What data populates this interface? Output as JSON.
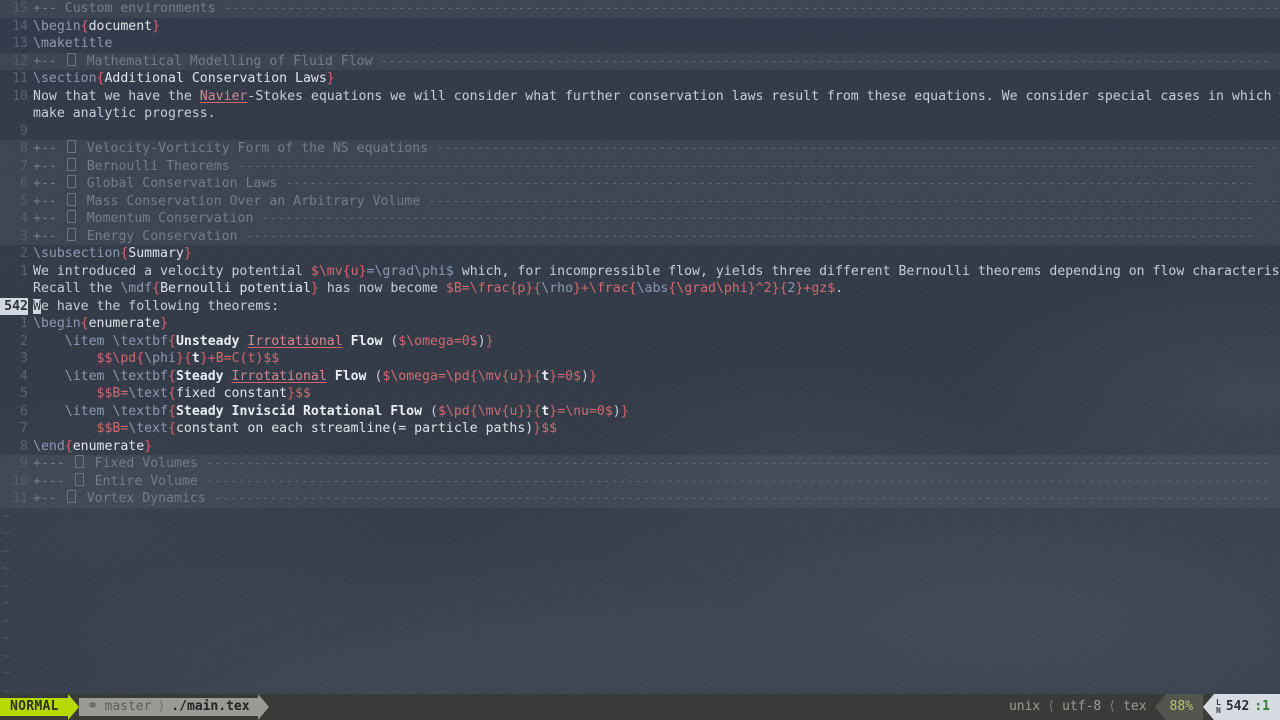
{
  "app": "neovim",
  "theme": {
    "background": "#333a47",
    "foreground": "#c8ccd4",
    "fold_bg": "#3c4453",
    "linenr": "#5a6373",
    "command": "#8b9ab3",
    "brace": "#d4636b",
    "math": "#cf6a6f",
    "spell_error_underline": "#d4636b",
    "mode_accent": "#b8d900",
    "position_accent": "#2e7d32"
  },
  "buffer": {
    "filename": "./main.tex",
    "filetype": "tex",
    "lines": [
      {
        "num": "15",
        "type": "fold",
        "marker": "+--",
        "title": "Custom environments",
        "dashes": "---------------------------------------------------------------------------------------------------------------------------------------------",
        "has_box": false
      },
      {
        "num": "14",
        "type": "code",
        "tokens": [
          {
            "t": "\\begin",
            "c": "cmd"
          },
          {
            "t": "{",
            "c": "brace"
          },
          {
            "t": "document",
            "c": "arg"
          },
          {
            "t": "}",
            "c": "brace"
          }
        ]
      },
      {
        "num": "13",
        "type": "code",
        "tokens": [
          {
            "t": "\\maketitle",
            "c": "cmd"
          }
        ]
      },
      {
        "num": "12",
        "type": "fold",
        "marker": "+--",
        "title": "Mathematical Modelling of Fluid Flow",
        "dashes": "----------------------------------------------------------------------------------------------------------------",
        "has_box": true
      },
      {
        "num": "11",
        "type": "code",
        "tokens": [
          {
            "t": "\\section",
            "c": "cmd"
          },
          {
            "t": "{",
            "c": "brace"
          },
          {
            "t": "Additional Conservation Laws",
            "c": "arg"
          },
          {
            "t": "}",
            "c": "brace"
          }
        ]
      },
      {
        "num": "10",
        "type": "code",
        "tokens": [
          {
            "t": "Now that we have the ",
            "c": "plain"
          },
          {
            "t": "Navier",
            "c": "spell"
          },
          {
            "t": "-Stokes equations we will consider what further conservation laws result from these equations. We consider special cases in which we can",
            "c": "plain"
          }
        ]
      },
      {
        "num": "",
        "type": "wrap",
        "tokens": [
          {
            "t": "make analytic progress.",
            "c": "plain"
          }
        ]
      },
      {
        "num": "9",
        "type": "code",
        "tokens": []
      },
      {
        "num": "8",
        "type": "fold",
        "marker": "+--",
        "title": "Velocity-Vorticity Form of the NS equations",
        "dashes": "----------------------------------------------------------------------------------------------------------",
        "has_box": true
      },
      {
        "num": "7",
        "type": "fold",
        "marker": "+--",
        "title": "Bernoulli Theorems",
        "dashes": "--------------------------------------------------------------------------------------------------------------------------------",
        "has_box": true
      },
      {
        "num": "6",
        "type": "fold",
        "marker": "+--",
        "title": "Global Conservation Laws",
        "dashes": "--------------------------------------------------------------------------------------------------------------------------",
        "has_box": true
      },
      {
        "num": "5",
        "type": "fold",
        "marker": "+--",
        "title": "Mass Conservation Over an Arbitrary Volume",
        "dashes": "------------------------------------------------------------------------------------------------------------",
        "has_box": true
      },
      {
        "num": "4",
        "type": "fold",
        "marker": "+--",
        "title": "Momentum Conservation",
        "dashes": "-----------------------------------------------------------------------------------------------------------------------------",
        "has_box": true
      },
      {
        "num": "3",
        "type": "fold",
        "marker": "+--",
        "title": "Energy Conservation",
        "dashes": "-------------------------------------------------------------------------------------------------------------------------------",
        "has_box": true
      },
      {
        "num": "2",
        "type": "code",
        "tokens": [
          {
            "t": "\\subsection",
            "c": "cmd"
          },
          {
            "t": "{",
            "c": "brace"
          },
          {
            "t": "Summary",
            "c": "arg"
          },
          {
            "t": "}",
            "c": "brace"
          }
        ]
      },
      {
        "num": "1",
        "type": "code",
        "tokens": [
          {
            "t": "We introduced a velocity potential ",
            "c": "plain"
          },
          {
            "t": "$\\mv",
            "c": "math"
          },
          {
            "t": "{",
            "c": "brace"
          },
          {
            "t": "u",
            "c": "math"
          },
          {
            "t": "}",
            "c": "brace"
          },
          {
            "t": "=\\grad\\phi$",
            "c": "mathblue"
          },
          {
            "t": " which, for incompressible flow, yields three different Bernoulli theorems depending on flow characteristics.",
            "c": "plain"
          }
        ]
      },
      {
        "num": "",
        "type": "wrap",
        "tokens": [
          {
            "t": "Recall the ",
            "c": "plain"
          },
          {
            "t": "\\mdf",
            "c": "cmd"
          },
          {
            "t": "{",
            "c": "brace"
          },
          {
            "t": "Bernoulli potential",
            "c": "arg"
          },
          {
            "t": "}",
            "c": "brace"
          },
          {
            "t": " has now become ",
            "c": "plain"
          },
          {
            "t": "$B=\\frac",
            "c": "math"
          },
          {
            "t": "{",
            "c": "brace"
          },
          {
            "t": "p",
            "c": "math"
          },
          {
            "t": "}",
            "c": "brace"
          },
          {
            "t": "{",
            "c": "brace"
          },
          {
            "t": "\\rho",
            "c": "mathblue"
          },
          {
            "t": "}",
            "c": "brace"
          },
          {
            "t": "+\\frac",
            "c": "math"
          },
          {
            "t": "{",
            "c": "brace"
          },
          {
            "t": "\\abs",
            "c": "mathblue"
          },
          {
            "t": "{",
            "c": "brace"
          },
          {
            "t": "\\grad\\phi",
            "c": "math"
          },
          {
            "t": "}",
            "c": "brace"
          },
          {
            "t": "^2",
            "c": "math"
          },
          {
            "t": "}",
            "c": "brace"
          },
          {
            "t": "{",
            "c": "brace"
          },
          {
            "t": "2",
            "c": "mathblue"
          },
          {
            "t": "}",
            "c": "brace"
          },
          {
            "t": "+gz$",
            "c": "math"
          },
          {
            "t": ".",
            "c": "plain"
          }
        ]
      },
      {
        "num": "542",
        "type": "cursor",
        "cursor_char": "W",
        "tokens": [
          {
            "t": "e have the following theorems:",
            "c": "plain"
          }
        ]
      },
      {
        "num": "1",
        "type": "code",
        "tokens": [
          {
            "t": "\\begin",
            "c": "cmd"
          },
          {
            "t": "{",
            "c": "brace"
          },
          {
            "t": "enumerate",
            "c": "arg"
          },
          {
            "t": "}",
            "c": "brace"
          }
        ]
      },
      {
        "num": "2",
        "type": "code",
        "tokens": [
          {
            "t": "    ",
            "c": "plain"
          },
          {
            "t": "\\item ",
            "c": "cmd"
          },
          {
            "t": "\\textbf",
            "c": "cmd"
          },
          {
            "t": "{",
            "c": "brace"
          },
          {
            "t": "Unsteady ",
            "c": "bold"
          },
          {
            "t": "Irrotational",
            "c": "spell"
          },
          {
            "t": " Flow ",
            "c": "bold"
          },
          {
            "t": "(",
            "c": "plain"
          },
          {
            "t": "$\\omega=0$",
            "c": "math"
          },
          {
            "t": ")",
            "c": "plain"
          },
          {
            "t": "}",
            "c": "brace"
          }
        ]
      },
      {
        "num": "3",
        "type": "code",
        "tokens": [
          {
            "t": "        ",
            "c": "plain"
          },
          {
            "t": "$$\\pd",
            "c": "math"
          },
          {
            "t": "{",
            "c": "brace"
          },
          {
            "t": "\\phi",
            "c": "mathblue"
          },
          {
            "t": "}",
            "c": "brace"
          },
          {
            "t": "{",
            "c": "brace"
          },
          {
            "t": "t",
            "c": "bold"
          },
          {
            "t": "}",
            "c": "brace"
          },
          {
            "t": "+B=C(t)$$",
            "c": "math"
          }
        ]
      },
      {
        "num": "4",
        "type": "code",
        "tokens": [
          {
            "t": "    ",
            "c": "plain"
          },
          {
            "t": "\\item ",
            "c": "cmd"
          },
          {
            "t": "\\textbf",
            "c": "cmd"
          },
          {
            "t": "{",
            "c": "brace"
          },
          {
            "t": "Steady ",
            "c": "bold"
          },
          {
            "t": "Irrotational",
            "c": "spell"
          },
          {
            "t": " Flow ",
            "c": "bold"
          },
          {
            "t": "(",
            "c": "plain"
          },
          {
            "t": "$\\omega=\\pd",
            "c": "math"
          },
          {
            "t": "{",
            "c": "brace"
          },
          {
            "t": "\\mv",
            "c": "math"
          },
          {
            "t": "{",
            "c": "brace"
          },
          {
            "t": "u",
            "c": "math"
          },
          {
            "t": "}",
            "c": "brace"
          },
          {
            "t": "}",
            "c": "brace"
          },
          {
            "t": "{",
            "c": "brace"
          },
          {
            "t": "t",
            "c": "bold"
          },
          {
            "t": "}",
            "c": "brace"
          },
          {
            "t": "=0$",
            "c": "math"
          },
          {
            "t": ")",
            "c": "plain"
          },
          {
            "t": "}",
            "c": "brace"
          }
        ]
      },
      {
        "num": "5",
        "type": "code",
        "tokens": [
          {
            "t": "        ",
            "c": "plain"
          },
          {
            "t": "$$B=",
            "c": "math"
          },
          {
            "t": "\\text",
            "c": "cmd"
          },
          {
            "t": "{",
            "c": "brace"
          },
          {
            "t": "fixed constant",
            "c": "arg"
          },
          {
            "t": "}",
            "c": "brace"
          },
          {
            "t": "$$",
            "c": "math"
          }
        ]
      },
      {
        "num": "6",
        "type": "code",
        "tokens": [
          {
            "t": "    ",
            "c": "plain"
          },
          {
            "t": "\\item ",
            "c": "cmd"
          },
          {
            "t": "\\textbf",
            "c": "cmd"
          },
          {
            "t": "{",
            "c": "brace"
          },
          {
            "t": "Steady Inviscid Rotational Flow ",
            "c": "bold"
          },
          {
            "t": "(",
            "c": "plain"
          },
          {
            "t": "$\\pd",
            "c": "math"
          },
          {
            "t": "{",
            "c": "brace"
          },
          {
            "t": "\\mv",
            "c": "math"
          },
          {
            "t": "{",
            "c": "brace"
          },
          {
            "t": "u",
            "c": "math"
          },
          {
            "t": "}",
            "c": "brace"
          },
          {
            "t": "}",
            "c": "brace"
          },
          {
            "t": "{",
            "c": "brace"
          },
          {
            "t": "t",
            "c": "bold"
          },
          {
            "t": "}",
            "c": "brace"
          },
          {
            "t": "=\\nu=0$",
            "c": "math"
          },
          {
            "t": ")",
            "c": "plain"
          },
          {
            "t": "}",
            "c": "brace"
          }
        ]
      },
      {
        "num": "7",
        "type": "code",
        "tokens": [
          {
            "t": "        ",
            "c": "plain"
          },
          {
            "t": "$$B=",
            "c": "math"
          },
          {
            "t": "\\text",
            "c": "cmd"
          },
          {
            "t": "{",
            "c": "brace"
          },
          {
            "t": "constant on each streamline(= particle paths)",
            "c": "arg"
          },
          {
            "t": "}",
            "c": "brace"
          },
          {
            "t": "$$",
            "c": "math"
          }
        ]
      },
      {
        "num": "8",
        "type": "code",
        "tokens": [
          {
            "t": "\\end",
            "c": "cmd"
          },
          {
            "t": "{",
            "c": "brace"
          },
          {
            "t": "enumerate",
            "c": "arg"
          },
          {
            "t": "}",
            "c": "brace"
          }
        ]
      },
      {
        "num": "9",
        "type": "fold",
        "marker": "+---",
        "title": "Fixed Volumes",
        "dashes": "--------------------------------------------------------------------------------------------------------------------------------------",
        "has_box": true
      },
      {
        "num": "10",
        "type": "fold",
        "marker": "+---",
        "title": "Entire Volume",
        "dashes": "--------------------------------------------------------------------------------------------------------------------------------------",
        "has_box": true
      },
      {
        "num": "11",
        "type": "fold",
        "marker": "+--",
        "title": "Vortex Dynamics",
        "dashes": "-------------------------------------------------------------------------------------------------------------------------------------",
        "has_box": true
      }
    ],
    "empty_marker": "~",
    "empty_line_count": 11
  },
  "statusline": {
    "mode": "NORMAL",
    "git_icon": "git-branch-icon",
    "branch": "master",
    "file": "./main.tex",
    "fileformat": "unix",
    "encoding": "utf-8",
    "filetype": "tex",
    "percent": "88%",
    "position": "542:1",
    "line": "542",
    "column": "1",
    "position_icon": "line-number-icon"
  }
}
